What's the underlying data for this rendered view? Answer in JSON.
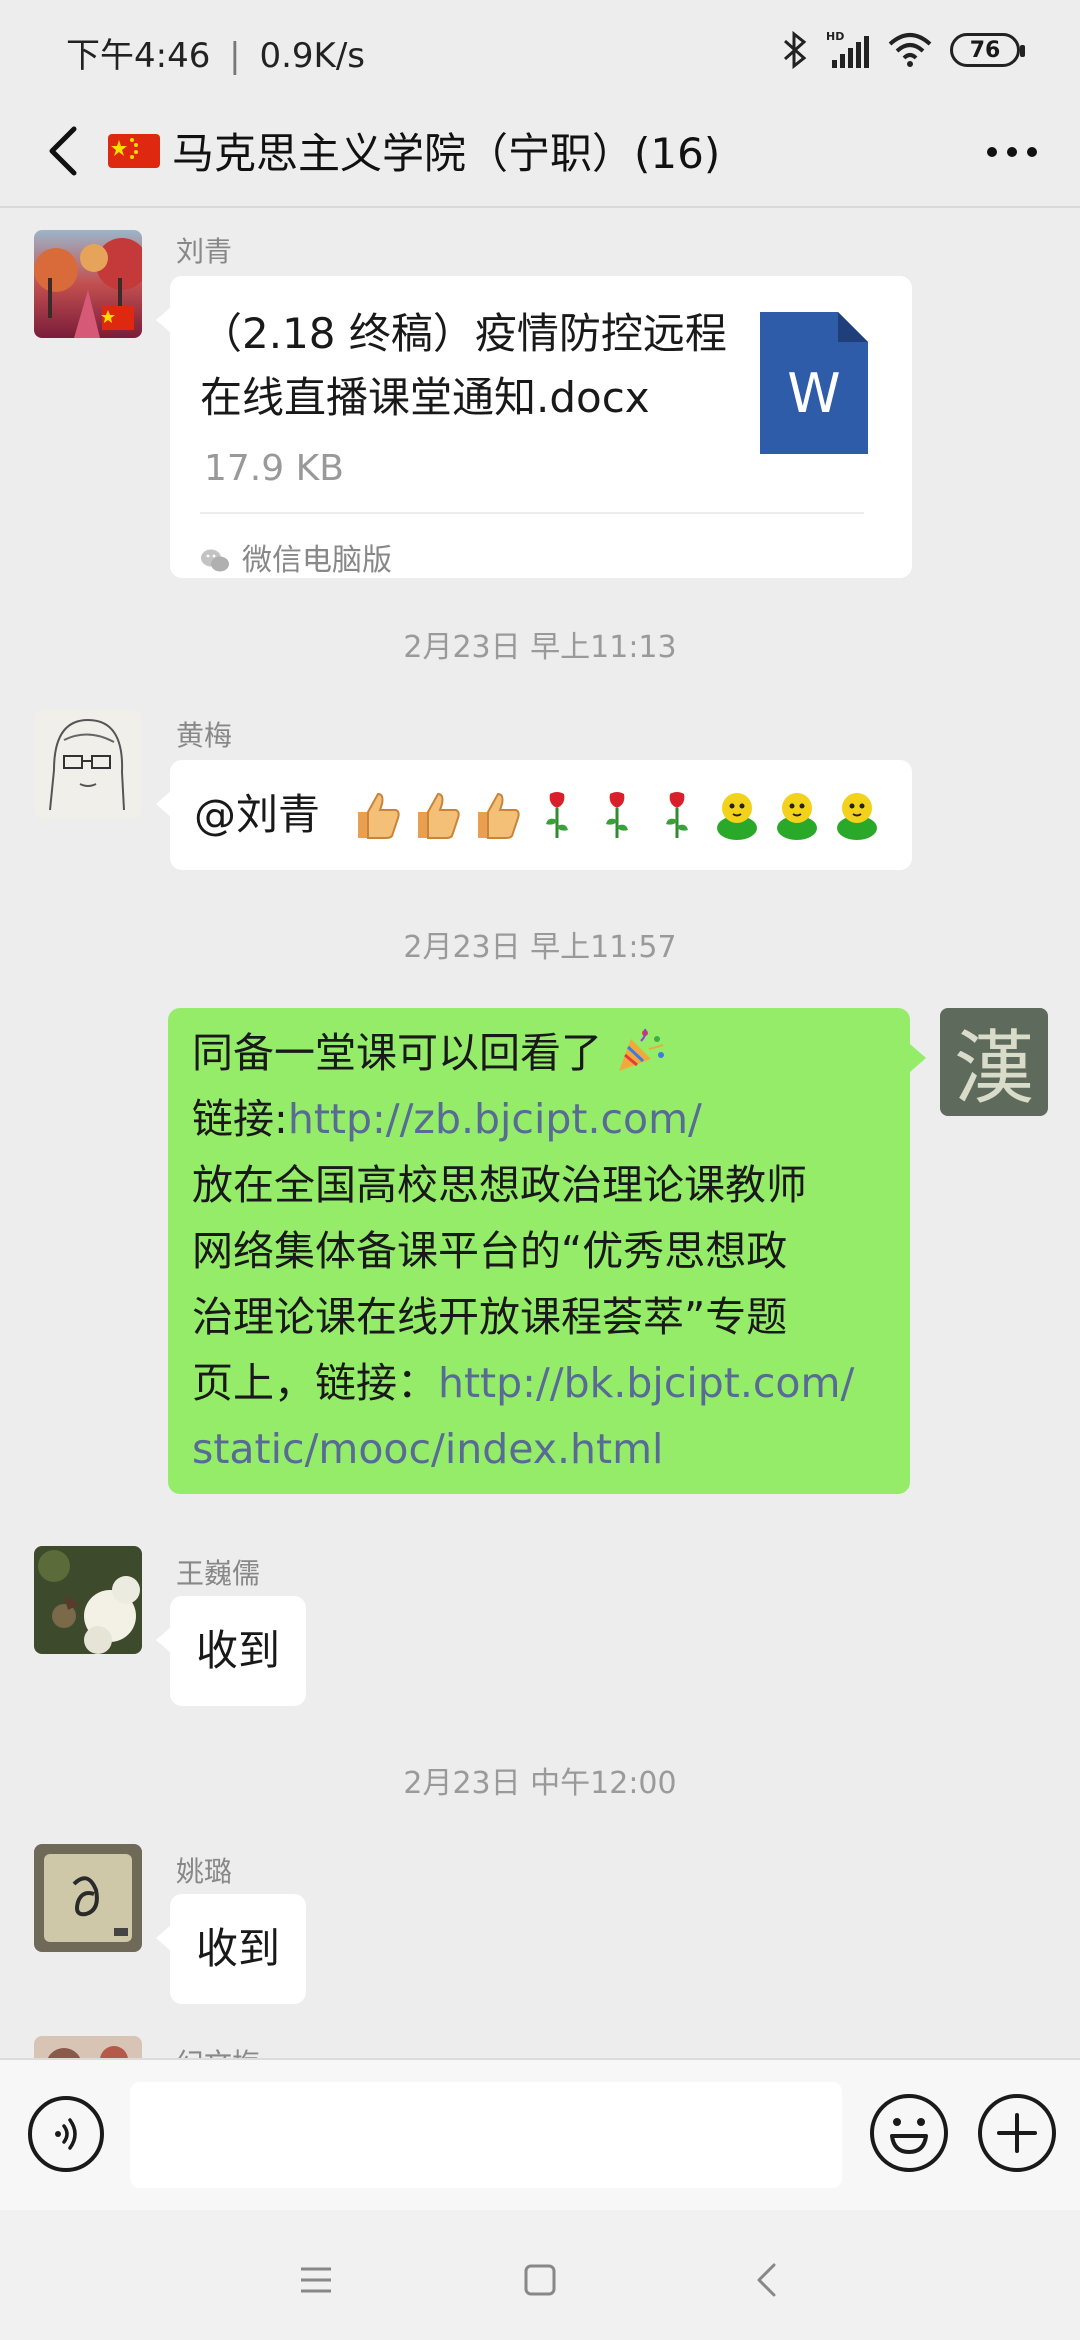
{
  "status_bar": {
    "time": "下午4:46",
    "separator": "|",
    "speed": "0.9K/s",
    "battery": "76",
    "icons": [
      "bluetooth-icon",
      "hd-signal-icon",
      "wifi-icon",
      "battery-icon"
    ]
  },
  "header": {
    "title": "马克思主义学院（宁职）(16)",
    "back_icon": "back-chevron-icon",
    "more_icon": "more-dots-icon",
    "flag_icon": "china-flag-icon"
  },
  "messages": [
    {
      "type": "file",
      "sender": "刘青",
      "file_name": "（2.18 终稿）疫情防控远程在线直播课堂通知.docx",
      "file_line1": "（2.18 终稿）疫情防控远程",
      "file_line2": "在线直播课堂通知.docx",
      "file_size": "17.9 KB",
      "source": "微信电脑版",
      "file_icon_letter": "W"
    },
    {
      "type": "timestamp",
      "text": "2月23日 早上11:13"
    },
    {
      "type": "text",
      "sender": "黄梅",
      "text": "@刘青",
      "emojis": [
        "thumbs-up-icon",
        "thumbs-up-icon",
        "thumbs-up-icon",
        "rose-icon",
        "rose-icon",
        "rose-icon",
        "green-chick-icon",
        "green-chick-icon",
        "green-chick-icon"
      ]
    },
    {
      "type": "timestamp",
      "text": "2月23日 早上11:57"
    },
    {
      "type": "text",
      "sender": "self",
      "line1": "同备一堂课可以回看了",
      "line2_prefix": "链接:",
      "line2_link": "http://zb.bjcipt.com/",
      "line3": "放在全国高校思想政治理论课教师",
      "line4": "网络集体备课平台的“优秀思想政",
      "line5": "治理论课在线开放课程荟萃”专题",
      "line6_prefix": "页上，链接：",
      "line6_link": "http://bk.bjcipt.com/",
      "line7_link": "static/mooc/index.html",
      "avatar_char": "漢"
    },
    {
      "type": "text",
      "sender": "王巍儒",
      "text": "收到"
    },
    {
      "type": "timestamp",
      "text": "2月23日 中午12:00"
    },
    {
      "type": "text",
      "sender": "姚璐",
      "text": "收到"
    },
    {
      "type": "partial",
      "sender": "纪文梅"
    }
  ],
  "input_bar": {
    "placeholder": "",
    "voice_icon": "voice-icon",
    "emoji_icon": "emoji-icon",
    "plus_icon": "plus-icon"
  },
  "system_nav": [
    "menu-icon",
    "home-icon",
    "back-icon"
  ]
}
